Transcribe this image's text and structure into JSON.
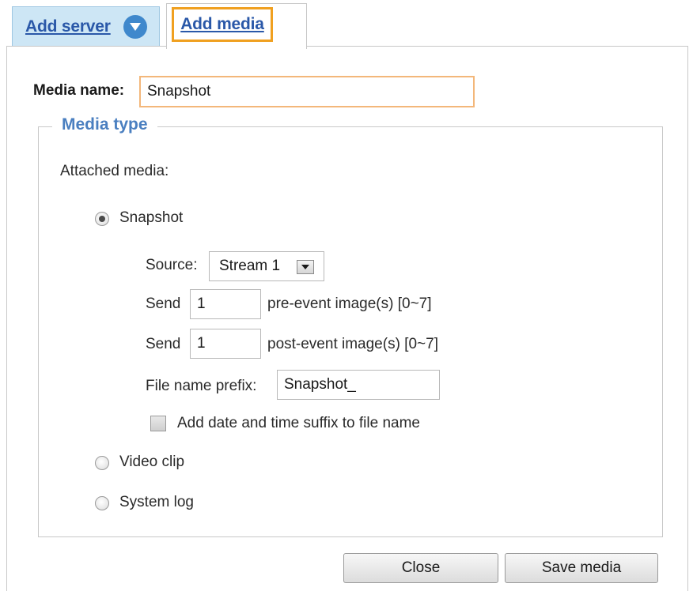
{
  "tabs": {
    "add_server": {
      "label": "Add server",
      "icon": "chevron-down-icon"
    },
    "add_media": {
      "label": "Add media"
    }
  },
  "media_name": {
    "label": "Media name:",
    "value": "Snapshot"
  },
  "media_type": {
    "legend": "Media type",
    "attached_label": "Attached media:",
    "options": [
      {
        "label": "Snapshot",
        "selected": true
      },
      {
        "label": "Video clip",
        "selected": false
      },
      {
        "label": "System log",
        "selected": false
      }
    ]
  },
  "snapshot": {
    "source_label": "Source:",
    "source_value": "Stream 1",
    "pre_send_label": "Send",
    "pre_value": "1",
    "pre_suffix": "pre-event image(s) [0~7]",
    "post_send_label": "Send",
    "post_value": "1",
    "post_suffix": "post-event image(s) [0~7]",
    "prefix_label": "File name prefix:",
    "prefix_value": "Snapshot_",
    "suffix_checkbox_label": "Add date and time suffix to file name",
    "suffix_checked": false
  },
  "buttons": {
    "close": "Close",
    "save": "Save media"
  },
  "colors": {
    "tab_active_highlight": "#f0a020",
    "link": "#2a58a8",
    "legend": "#4a7fc0",
    "tab_inactive_bg": "#cde6f5",
    "icon_blue": "#3f88cc",
    "input_focus_border": "#f3b77a"
  }
}
